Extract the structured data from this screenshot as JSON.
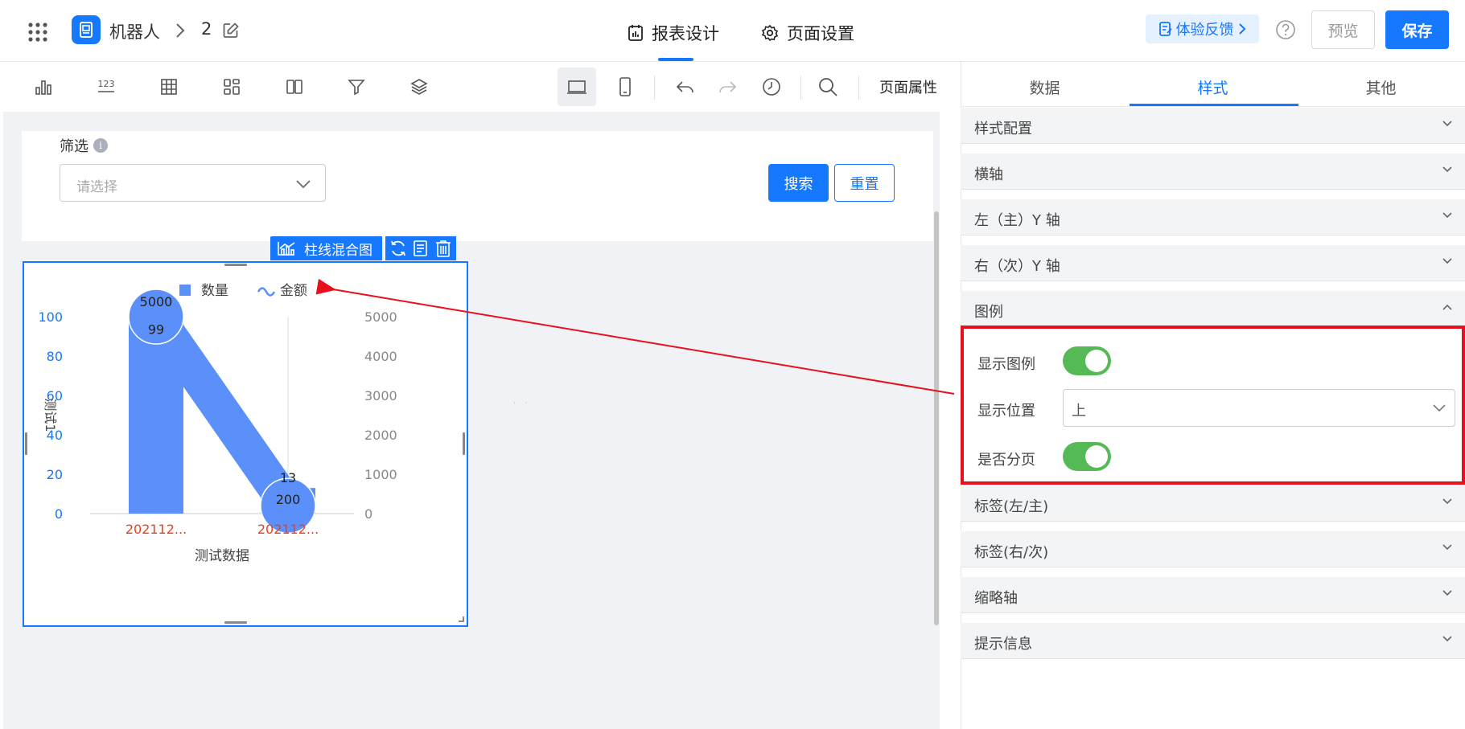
{
  "header": {
    "app_name": "机器人",
    "page_number": "2",
    "tabs": [
      {
        "label": "报表设计",
        "active": true,
        "icon": "report-icon"
      },
      {
        "label": "页面设置",
        "active": false,
        "icon": "gear-icon"
      }
    ],
    "feedback_label": "体验反馈",
    "preview_label": "预览",
    "save_label": "保存"
  },
  "toolbar": {
    "icons": [
      "bar-chart-icon",
      "number-icon",
      "table-icon",
      "grid-layout-icon",
      "column-layout-icon",
      "filter-icon",
      "layers-icon",
      "desktop-icon",
      "mobile-icon",
      "undo-icon",
      "redo-icon",
      "history-icon",
      "search-icon"
    ],
    "number_icon_text": "123",
    "page_props_label": "页面属性"
  },
  "filter": {
    "label": "筛选",
    "info_glyph": "i",
    "placeholder": "请选择",
    "search_label": "搜索",
    "reset_label": "重置"
  },
  "chart_widget": {
    "toolbar_title": "柱线混合图"
  },
  "chart_data": {
    "type": "bar",
    "legend": [
      {
        "name": "数量",
        "marker": "square",
        "color": "#5b8ff9"
      },
      {
        "name": "金额",
        "marker": "line",
        "color": "#5b8ff9"
      }
    ],
    "categories": [
      "202112...",
      "202112..."
    ],
    "series": [
      {
        "name": "数量",
        "type": "bar",
        "axis": "left",
        "values": [
          99,
          13
        ],
        "labels": [
          "99",
          "13"
        ]
      },
      {
        "name": "金额",
        "type": "line",
        "axis": "right",
        "values": [
          5000,
          200
        ],
        "labels": [
          "5000",
          "200"
        ]
      }
    ],
    "left_axis": {
      "label": "测试1",
      "min": 0,
      "max": 100,
      "ticks": [
        "0",
        "20",
        "40",
        "60",
        "80",
        "100"
      ],
      "color": "#1677ff"
    },
    "right_axis": {
      "min": 0,
      "max": 5000,
      "ticks": [
        "0",
        "1000",
        "2000",
        "3000",
        "4000",
        "5000"
      ],
      "color": "#888888"
    },
    "xlabel": "测试数据",
    "category_label_color": "#e8401c",
    "legend_position": "top"
  },
  "right_panel": {
    "tabs": [
      {
        "label": "数据",
        "active": false
      },
      {
        "label": "样式",
        "active": true
      },
      {
        "label": "其他",
        "active": false
      }
    ],
    "sections_top": [
      "样式配置",
      "横轴",
      "左（主）Y 轴",
      "右（次）Y 轴"
    ],
    "legend_section": {
      "title": "图例",
      "expanded": true,
      "show_legend_label": "显示图例",
      "show_legend": true,
      "position_label": "显示位置",
      "position_value": "上",
      "paging_label": "是否分页",
      "paging": true
    },
    "sections_bottom": [
      "标签(左/主)",
      "标签(右/次)",
      "缩略轴",
      "提示信息"
    ]
  },
  "colors": {
    "accent": "#1677ff",
    "toggle_on": "#55b955",
    "highlight": "#e8101c"
  }
}
